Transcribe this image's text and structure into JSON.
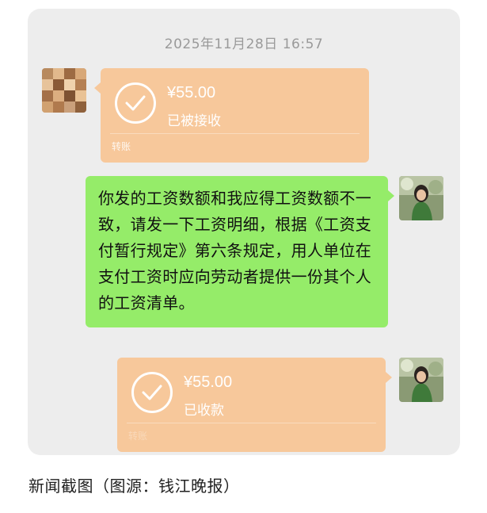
{
  "timestamp": "2025年11月28日 16:57",
  "messages": {
    "transfer_received": {
      "amount": "¥55.00",
      "status": "已被接收",
      "label": "转账"
    },
    "text": {
      "content": "你发的工资数额和我应得工资数额不一致，请发一下工资明细，根据《工资支付暂行规定》第六条规定，用人单位在支付工资时应向劳动者提供一份其个人的工资清单。"
    },
    "transfer_collected": {
      "amount": "¥55.00",
      "status": "已收款",
      "label": "转账"
    }
  },
  "caption": "新闻截图（图源：钱江晚报）",
  "colors": {
    "chat_background": "#ededed",
    "transfer_bubble": "#f7c89b",
    "text_bubble": "#95ec69"
  },
  "icons": {
    "transfer_check": "check-circle-icon"
  }
}
